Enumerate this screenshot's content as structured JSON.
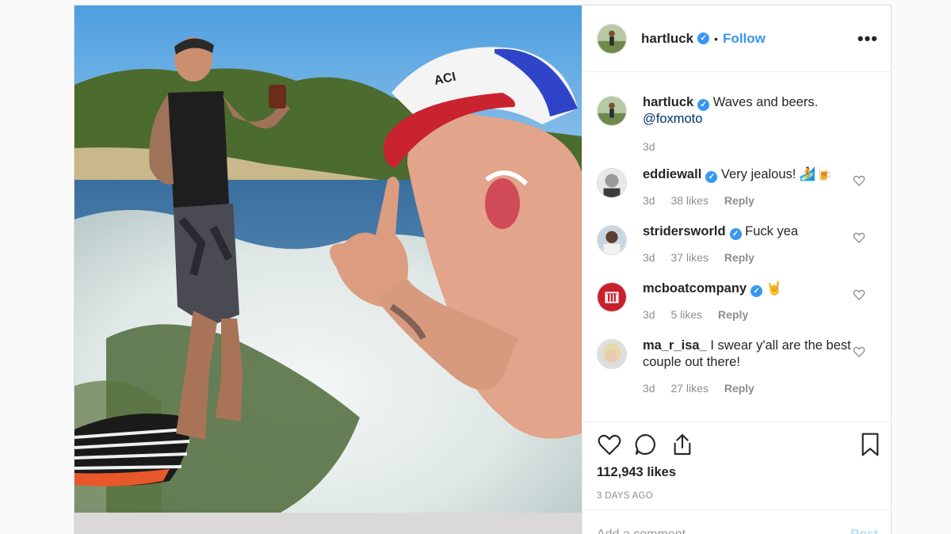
{
  "post": {
    "username": "hartluck",
    "verified_mark": "✓",
    "separator": "•",
    "follow_label": "Follow",
    "more_label": "•••"
  },
  "caption": {
    "username": "hartluck",
    "text": "Waves and beers.",
    "mention": "@foxmoto",
    "time": "3d"
  },
  "comments": [
    {
      "username": "eddiewall",
      "verified": true,
      "text": "Very jealous! 🏄🍺",
      "time": "3d",
      "likes": "38 likes",
      "reply": "Reply"
    },
    {
      "username": "stridersworld",
      "verified": true,
      "text": "Fuck yea",
      "time": "3d",
      "likes": "37 likes",
      "reply": "Reply"
    },
    {
      "username": "mcboatcompany",
      "verified": true,
      "text": "🤘",
      "time": "3d",
      "likes": "5 likes",
      "reply": "Reply"
    },
    {
      "username": "ma_r_isa_",
      "verified": false,
      "text": "I swear y'all are the best couple out there!",
      "time": "3d",
      "likes": "27 likes",
      "reply": "Reply"
    }
  ],
  "actions": {
    "likes": "112,943 likes",
    "date": "3 DAYS AGO"
  },
  "add_comment": {
    "placeholder": "Add a comment…",
    "post_label": "Post"
  },
  "icons": {
    "like": "heart-icon",
    "comment": "comment-bubble-icon",
    "share": "share-icon",
    "save": "bookmark-icon"
  },
  "colors": {
    "accent": "#3897f0",
    "text": "#262626",
    "muted": "#8e8e8e"
  }
}
